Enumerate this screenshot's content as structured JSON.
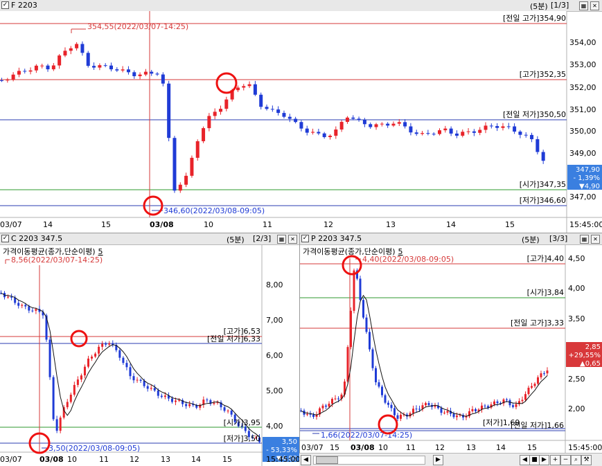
{
  "top_pane": {
    "title": "F 2203",
    "period": "(5분)",
    "page": "[1/3]",
    "ylabels": [
      "354,00",
      "353,00",
      "352,00",
      "351,00",
      "350,00",
      "349,00",
      "347,00"
    ],
    "xlabels": [
      "03/07",
      "14",
      "15",
      "03/08",
      "10",
      "11",
      "12",
      "13",
      "14",
      "15",
      "15:45:00"
    ],
    "lines": {
      "prev_high": "[전일 고가]354,90",
      "high": "[고가]352,35",
      "prev_low": "[전일 저가]350,50",
      "open": "[시가]347,35",
      "low": "[저가]346,60"
    },
    "annotations": {
      "max": "354,55(2022/03/07-14:25)",
      "min": "346,60(2022/03/08-09:05)"
    },
    "price_box": {
      "price": "347,90",
      "change_pct": "- 1,39%",
      "change": "▼4,90"
    },
    "colors": {
      "up": "#e8232a",
      "down": "#1f3bd6"
    }
  },
  "left_pane": {
    "title": "C 2203 347.5",
    "period": "(5분)",
    "page": "[2/3]",
    "legend": "가격이동평균(종가,단순이평)",
    "legend_value": "5",
    "ylabels": [
      "8,00",
      "7,00",
      "6,00",
      "5,00",
      "4,00"
    ],
    "xlabels": [
      "03/07",
      "03/08",
      "10",
      "11",
      "12",
      "13",
      "14",
      "15",
      "15:45:00"
    ],
    "lines": {
      "high": "[고가]6,53",
      "prev_low": "[전일 저가]6,33",
      "open": "[시가]3,95",
      "low": "[저가]3,50"
    },
    "annotations": {
      "max": "8,56(2022/03/07-14:25)",
      "min": "3,50(2022/03/08-09:05)"
    },
    "price_box": {
      "price": "3,50",
      "change_pct": "- 53,33%",
      "change": "▼4,00"
    }
  },
  "right_pane": {
    "title": "P 2203 347.5",
    "period": "(5분)",
    "page": "[3/3]",
    "legend": "가격이동평균(종가,단순이평)",
    "legend_value": "5",
    "ylabels": [
      "4,50",
      "4,00",
      "3,50",
      "2,50",
      "2,00"
    ],
    "xlabels": [
      "03/07",
      "15",
      "03/08",
      "10",
      "11",
      "12",
      "13",
      "14",
      "15",
      "15:45:00"
    ],
    "lines": {
      "high": "[고가]4,40",
      "open": "[시가]3,84",
      "prev_high": "[전일 고가]3,33",
      "low": "[저가]1,69",
      "prev_low": "[전일 저가]1,66"
    },
    "annotations": {
      "max": "4,40(2022/03/08-09:05)",
      "min": "1,66(2022/03/07-14:25)"
    },
    "price_box": {
      "price": "2,85",
      "change_pct": "+29,55%",
      "change": "▲0,65"
    }
  },
  "toolbar": {
    "icons": [
      "scroll-left-icon",
      "scroll-right-icon",
      "stop-icon",
      "play-icon",
      "zoom-in-icon",
      "zoom-out-icon",
      "search-icon",
      "settings-icon"
    ]
  }
}
